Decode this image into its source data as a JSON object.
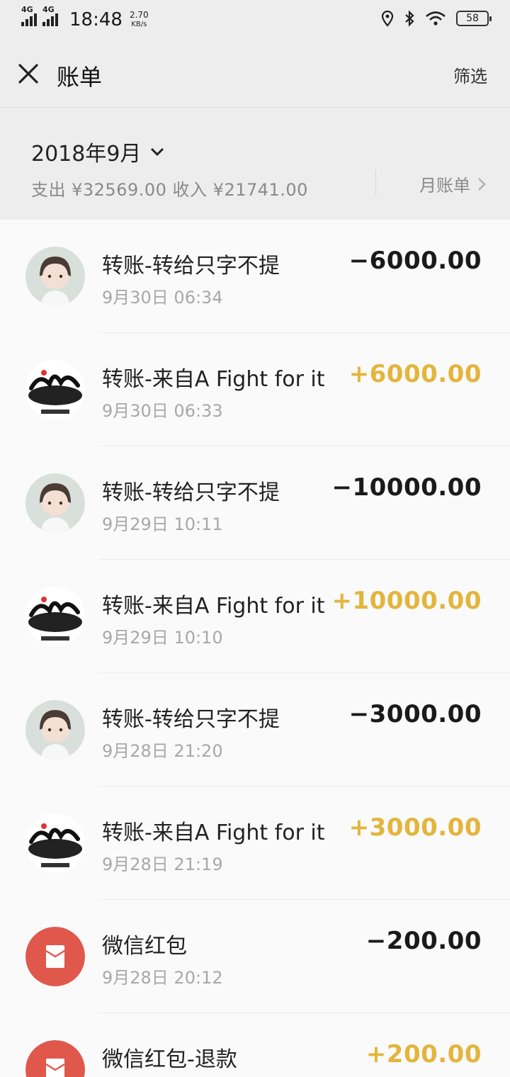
{
  "status_bar": {
    "network1": "4G",
    "network2": "4G",
    "time": "18:48",
    "speed_value": "2.70",
    "speed_unit": "KB/s",
    "battery": "58"
  },
  "header": {
    "title": "账单",
    "filter_label": "筛选"
  },
  "month": {
    "label": "2018年9月",
    "summary": "支出 ¥32569.00 收入 ¥21741.00",
    "monthly_bill_label": "月账单"
  },
  "colors": {
    "income": "#e3b53c",
    "expense": "#1a1a1a",
    "red_packet": "#e0584c"
  },
  "transactions": [
    {
      "title": "转账-转给只字不提",
      "time": "9月30日 06:34",
      "amount": "−6000.00",
      "direction": "out",
      "avatar": "girl-avatar"
    },
    {
      "title": "转账-来自A Fight for it",
      "time": "9月30日 06:33",
      "amount": "+6000.00",
      "direction": "in",
      "avatar": "calligraphy-avatar"
    },
    {
      "title": "转账-转给只字不提",
      "time": "9月29日 10:11",
      "amount": "−10000.00",
      "direction": "out",
      "avatar": "girl-avatar"
    },
    {
      "title": "转账-来自A Fight for it",
      "time": "9月29日 10:10",
      "amount": "+10000.00",
      "direction": "in",
      "avatar": "calligraphy-avatar"
    },
    {
      "title": "转账-转给只字不提",
      "time": "9月28日 21:20",
      "amount": "−3000.00",
      "direction": "out",
      "avatar": "girl-avatar"
    },
    {
      "title": "转账-来自A Fight for it",
      "time": "9月28日 21:19",
      "amount": "+3000.00",
      "direction": "in",
      "avatar": "calligraphy-avatar"
    },
    {
      "title": "微信红包",
      "time": "9月28日 20:12",
      "amount": "−200.00",
      "direction": "out",
      "avatar": "red-packet-icon"
    },
    {
      "title": "微信红包-退款",
      "time": "",
      "amount": "+200.00",
      "direction": "in",
      "avatar": "red-packet-icon"
    }
  ]
}
